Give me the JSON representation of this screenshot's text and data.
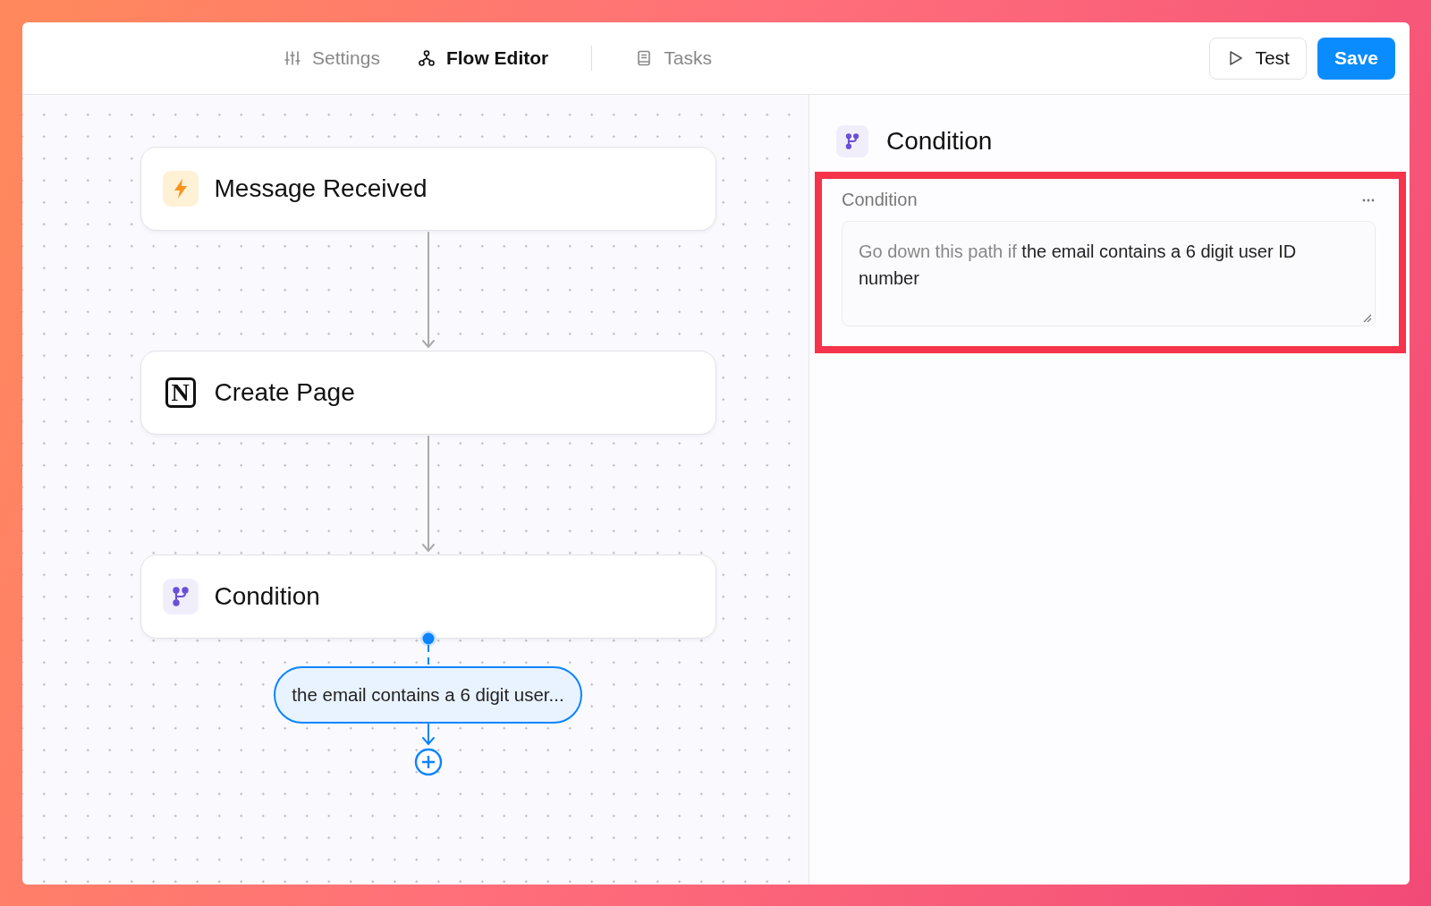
{
  "tabs": [
    {
      "label": "Settings",
      "kind": "sliders",
      "selected": false
    },
    {
      "label": "Flow Editor",
      "kind": "flow",
      "selected": true
    },
    {
      "label": "Tasks",
      "kind": "doc",
      "selected": false
    }
  ],
  "actions": [
    {
      "label": "Test",
      "kind": "secondary"
    },
    {
      "label": "Save",
      "kind": "primary"
    }
  ],
  "nodes": [
    {
      "title": "Message Received",
      "kind": "trigger"
    },
    {
      "title": "Create Page",
      "kind": "notion",
      "icon_text": "N"
    },
    {
      "title": "Condition",
      "kind": "condition"
    }
  ],
  "branch": {
    "label": "the email contains a 6 digit user..."
  },
  "panel": {
    "title": "Condition",
    "section_label": "Condition",
    "prefix": "Go down this path if",
    "value": "the email contains a 6 digit user ID number",
    "highlighted": true
  }
}
